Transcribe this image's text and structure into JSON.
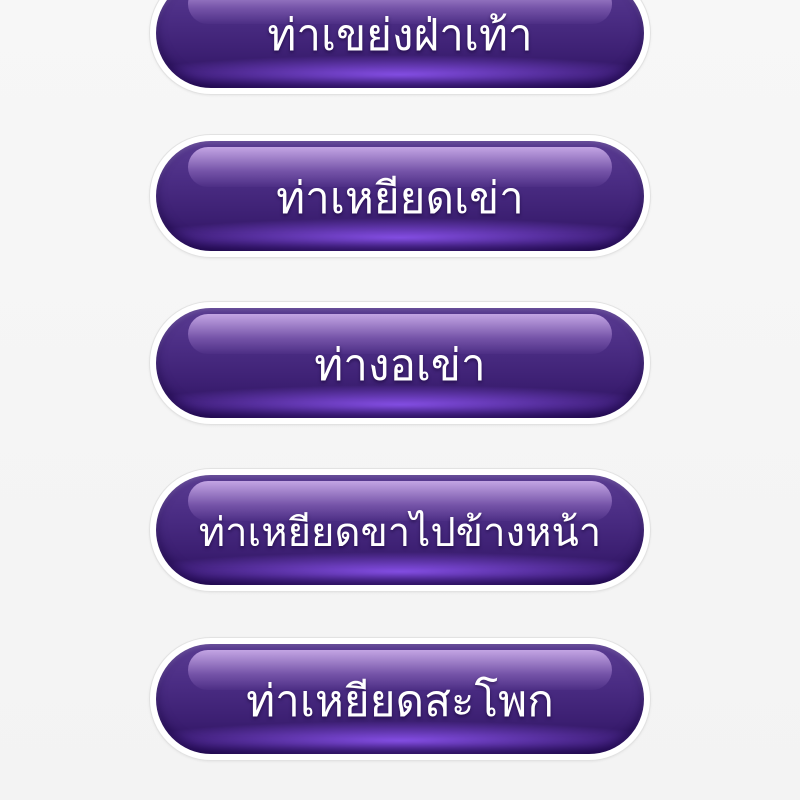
{
  "menu": {
    "items": [
      {
        "label": "ท่าเขย่งฝ่าเท้า"
      },
      {
        "label": "ท่าเหยียดเข่า"
      },
      {
        "label": "ท่างอเข่า"
      },
      {
        "label": "ท่าเหยียดขาไปข้างหน้า"
      },
      {
        "label": "ท่าเหยียดสะโพก"
      }
    ]
  },
  "colors": {
    "button_top": "#5a3c92",
    "button_bottom": "#2a0f5c",
    "button_glow": "#9660ff",
    "label": "#ffffff",
    "background": "#f6f6f6"
  }
}
